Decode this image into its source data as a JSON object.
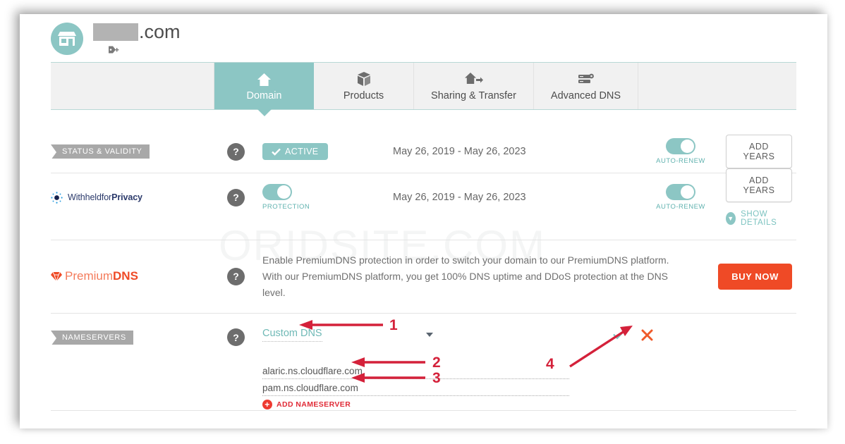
{
  "header": {
    "shop_icon": "storefront-icon",
    "domain_name_suffix": ".com",
    "domain_redacted": true,
    "tag_icon": "tag-plus-icon"
  },
  "watermark": "ORIDSITE.COM",
  "tabs": [
    {
      "label": "Domain",
      "icon": "home-icon",
      "active": true
    },
    {
      "label": "Products",
      "icon": "box-icon",
      "active": false
    },
    {
      "label": "Sharing & Transfer",
      "icon": "home-arrow-icon",
      "active": false
    },
    {
      "label": "Advanced DNS",
      "icon": "server-gear-icon",
      "active": false
    }
  ],
  "rows": {
    "status": {
      "ribbon_label": "STATUS & VALIDITY",
      "help_icon": "question-mark-icon",
      "badge_label": "ACTIVE",
      "badge_check_icon": "check-icon",
      "date_range": "May 26, 2019 - May 26, 2023",
      "toggle_label": "AUTO-RENEW",
      "toggle_on": true,
      "button_label": "ADD YEARS"
    },
    "privacy": {
      "logo_text_light": "Withheldfor",
      "logo_text_bold": "Privacy",
      "logo_icon": "privacy-burst-icon",
      "help_icon": "question-mark-icon",
      "toggle_label": "PROTECTION",
      "toggle_on": true,
      "date_range": "May 26, 2019 - May 26, 2023",
      "auto_renew_label": "AUTO-RENEW",
      "auto_renew_on": true,
      "button_label": "ADD YEARS",
      "show_details_label": "SHOW DETAILS",
      "show_details_icon": "chevron-down-icon"
    },
    "premiumdns": {
      "logo_light": "Premium",
      "logo_bold": "DNS",
      "logo_icon": "diamond-icon",
      "help_icon": "question-mark-icon",
      "copy_line_1": "Enable PremiumDNS protection in order to switch your domain to our PremiumDNS platform.",
      "copy_line_2": "With our PremiumDNS platform, you get 100% DNS uptime and DDoS protection at the DNS level.",
      "button_label": "BUY NOW"
    },
    "nameservers": {
      "ribbon_label": "NAMESERVERS",
      "help_icon": "question-mark-icon",
      "dns_type_value": "Custom DNS",
      "dropdown_icon": "caret-down-icon",
      "entries": [
        "alaric.ns.cloudflare.com",
        "pam.ns.cloudflare.com"
      ],
      "add_label": "ADD NAMESERVER",
      "add_icon": "plus-circle-icon",
      "confirm_icon": "check-icon",
      "cancel_icon": "close-icon"
    }
  },
  "annotations": [
    {
      "number": "1",
      "target": "dns-type-dropdown"
    },
    {
      "number": "2",
      "target": "nameserver-field-1"
    },
    {
      "number": "3",
      "target": "nameserver-field-2"
    },
    {
      "number": "4",
      "target": "confirm-check-button"
    }
  ],
  "colors": {
    "teal": "#8cc6c4",
    "orange": "#ef4a26",
    "annotation_red": "#d4213a",
    "gray_ribbon": "#a8a8a8"
  }
}
